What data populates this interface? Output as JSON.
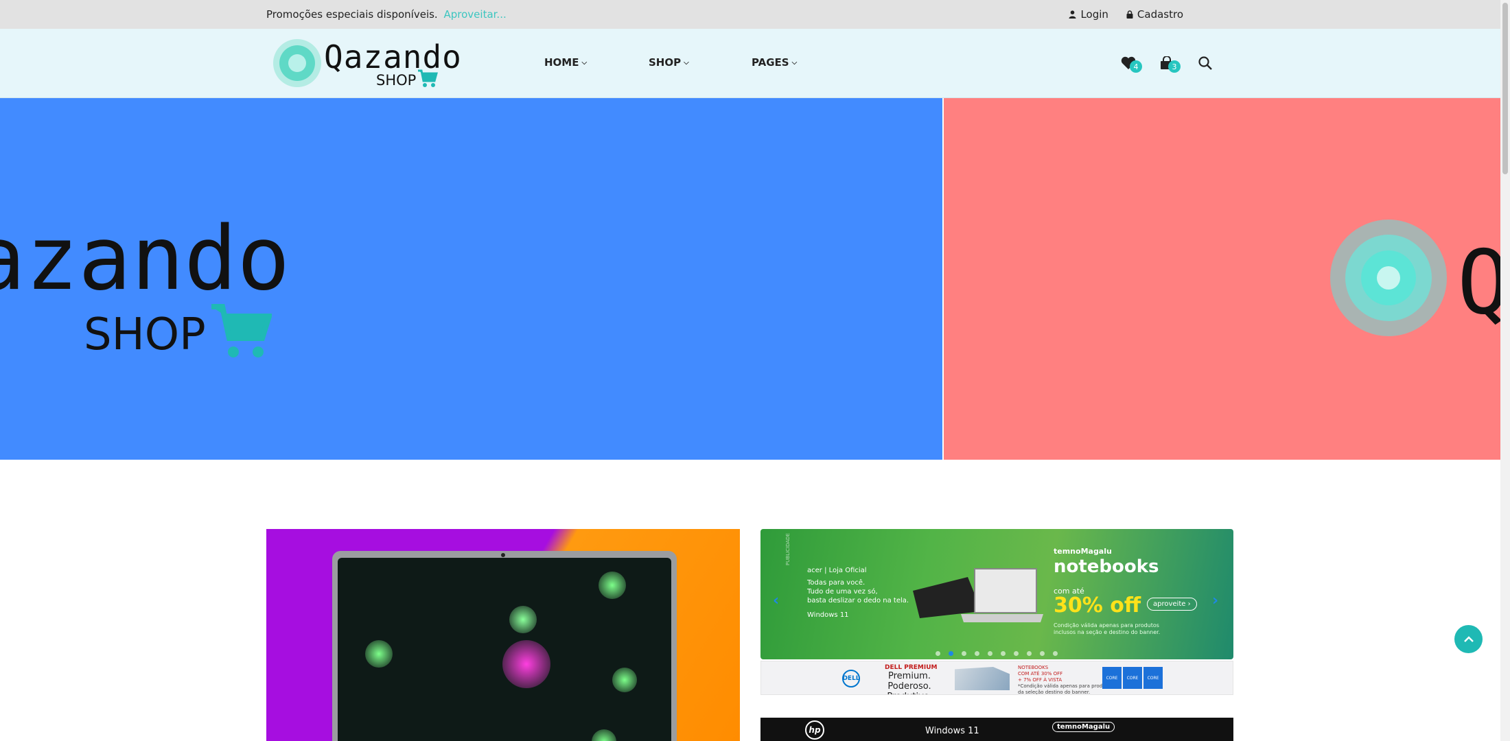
{
  "topbar": {
    "promo_text": "Promoções especiais disponíveis.",
    "promo_link": "Aproveitar...",
    "login_label": "Login",
    "signup_label": "Cadastro"
  },
  "header": {
    "logo_word": "Qazando",
    "logo_sub": "SHOP",
    "nav": [
      {
        "label": "HOME"
      },
      {
        "label": "SHOP"
      },
      {
        "label": "PAGES"
      }
    ],
    "wishlist_count": "4",
    "cart_count": "3"
  },
  "banner": {
    "blue_word": "azando",
    "blue_sub": "SHOP",
    "red_word": "Q",
    "colors": {
      "blue": "#428bff",
      "red": "#ff8080"
    }
  },
  "promo_card": {
    "publicidade": "PUBLICIDADE",
    "brand": "acer | Loja Oficial",
    "side_lines": [
      "Todas para você.",
      "Tudo de uma vez só,",
      "basta deslizar o dedo na tela."
    ],
    "windows": "Windows 11",
    "magalu": "temnoMagalu",
    "title": "notebooks",
    "ate": "com até",
    "off": "30% off",
    "button": "aproveite ›",
    "condition": [
      "Condição válida apenas para produtos",
      "inclusos na seção e destino do banner."
    ],
    "dots": 10,
    "active_dot": 1
  },
  "dell_strip": {
    "logo": "DELL",
    "premium_label": "DELL PREMIUM",
    "tagline": "Premium. Poderoso. Produtivo.",
    "offer_lines": [
      "NOTEBOOKS",
      "COM ATÉ 30% OFF",
      "+ 7% OFF À VISTA",
      "*Condição válida apenas para produtos",
      "da seleção destino do banner."
    ],
    "chips": [
      "CORE",
      "CORE",
      "CORE"
    ]
  },
  "hp_strip": {
    "logo": "hp",
    "windows": "Windows 11",
    "magalu": "temnoMagalu"
  }
}
